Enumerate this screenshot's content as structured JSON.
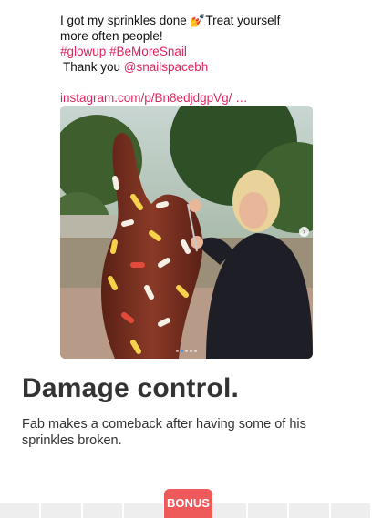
{
  "tweet": {
    "line1": "I got my sprinkles done 💅Treat yourself",
    "line2": "more often people!",
    "hashtags": "#glowup #BeMoreSnail",
    "thanks_prefix": "Thank you ",
    "mention": "@snailspacebh",
    "link": "instagram.com/p/Bn8edjdgpVg/  …"
  },
  "photo": {
    "alt": "Woman repairing sprinkles on a chocolate snail sculpture",
    "carousel_dots": 5,
    "active_dot": 1
  },
  "article": {
    "headline": "Damage control.",
    "description": "Fab makes a comeback after having some of his sprinkles broken."
  },
  "bottom_bar": {
    "bonus_label": "BONUS",
    "accent_color": "#ee5a5a"
  }
}
